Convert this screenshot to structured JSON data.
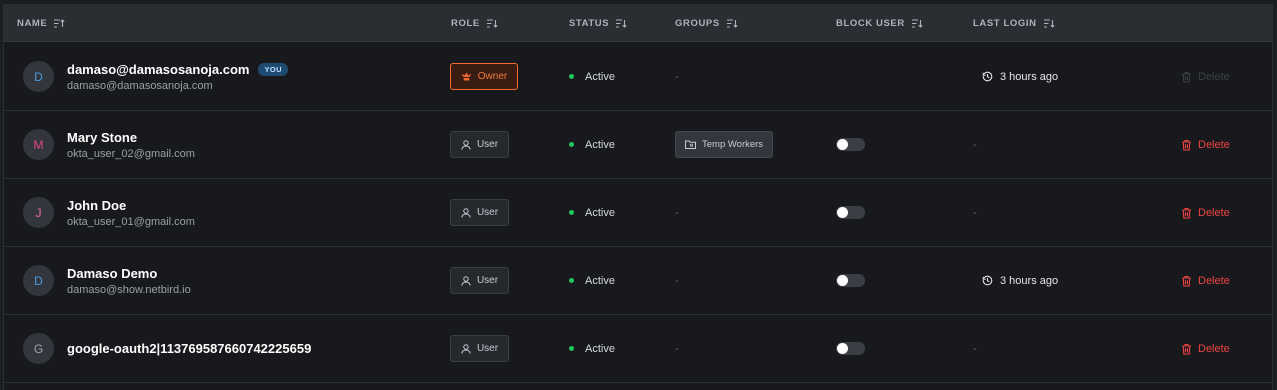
{
  "columns": {
    "name": "NAME",
    "role": "ROLE",
    "status": "STATUS",
    "groups": "GROUPS",
    "block_user": "BLOCK USER",
    "last_login": "LAST LOGIN"
  },
  "colors": {
    "accent_owner": "#f36b2f",
    "status_active": "#22c55e",
    "delete": "#ef4444",
    "you_badge": "#1e4b70"
  },
  "rows": [
    {
      "initial": "D",
      "initial_color": "#4b9be0",
      "name": "damaso@damasosanoja.com",
      "you_badge": "YOU",
      "email": "damaso@damasosanoja.com",
      "role": "Owner",
      "role_icon": "shield-crown-icon",
      "status": "Active",
      "group": "-",
      "block_user": null,
      "last_login": "3 hours ago",
      "delete_label": "Delete",
      "delete_enabled": false
    },
    {
      "initial": "M",
      "initial_color": "#e0458f",
      "name": "Mary Stone",
      "email": "okta_user_02@gmail.com",
      "role": "User",
      "role_icon": "user-icon",
      "status": "Active",
      "group": "Temp Workers",
      "block_user": false,
      "last_login": "-",
      "delete_label": "Delete",
      "delete_enabled": true
    },
    {
      "initial": "J",
      "initial_color": "#e86a9a",
      "name": "John Doe",
      "email": "okta_user_01@gmail.com",
      "role": "User",
      "role_icon": "user-icon",
      "status": "Active",
      "group": "-",
      "block_user": false,
      "last_login": "-",
      "delete_label": "Delete",
      "delete_enabled": true
    },
    {
      "initial": "D",
      "initial_color": "#4b9be0",
      "name": "Damaso Demo",
      "email": "damaso@show.netbird.io",
      "role": "User",
      "role_icon": "user-icon",
      "status": "Active",
      "group": "-",
      "block_user": false,
      "last_login": "3 hours ago",
      "delete_label": "Delete",
      "delete_enabled": true
    },
    {
      "initial": "G",
      "initial_color": "#a0a4ab",
      "name": "google-oauth2|113769587660742225659",
      "email": "",
      "role": "User",
      "role_icon": "user-icon",
      "status": "Active",
      "group": "-",
      "block_user": false,
      "last_login": "-",
      "delete_label": "Delete",
      "delete_enabled": true
    }
  ]
}
